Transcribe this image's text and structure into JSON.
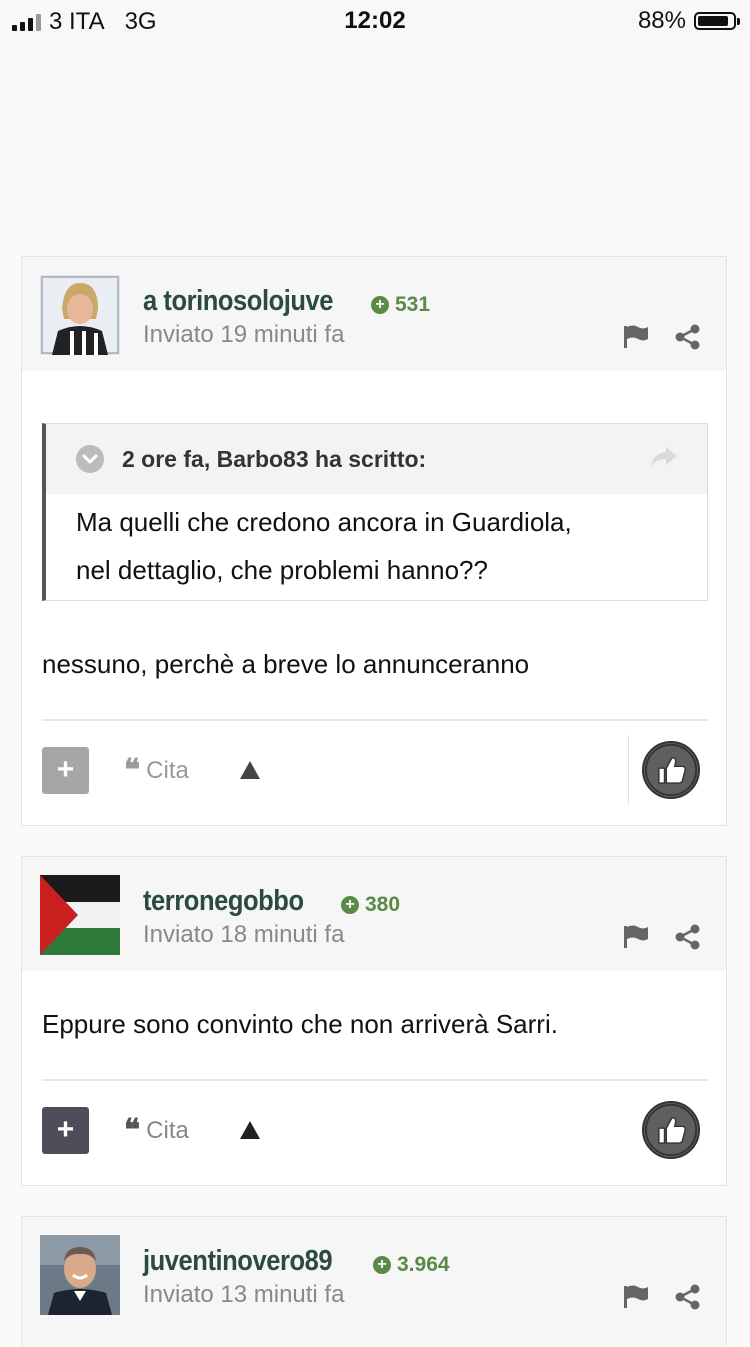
{
  "status_bar": {
    "carrier": "3 ITA",
    "network": "3G",
    "time": "12:02",
    "battery": "88%",
    "battery_level": 0.88
  },
  "posts": [
    {
      "username": "a torinosolojuve",
      "reputation": "531",
      "posted": "Inviato 19 minuti fa",
      "quote": {
        "header": "2 ore fa, Barbo83 ha scritto:",
        "line1": "Ma quelli che credono ancora in Guardiola,",
        "line2": "nel dettaglio, che problemi hanno??"
      },
      "text": "nessuno, perchè a breve lo annunceranno",
      "cita_label": "Cita"
    },
    {
      "username": "terronegobbo",
      "reputation": "380",
      "posted": "Inviato 18 minuti fa",
      "text": "Eppure sono convinto che non arriverà Sarri.",
      "cita_label": "Cita"
    },
    {
      "username": "juventinovero89",
      "reputation": "3.964",
      "posted": "Inviato 13 minuti fa"
    }
  ],
  "colors": {
    "username": "#2b4a42",
    "reputation": "#5a8a45",
    "plus_button_disabled": "#a6a6a6",
    "plus_button": "#4e4e5a"
  }
}
